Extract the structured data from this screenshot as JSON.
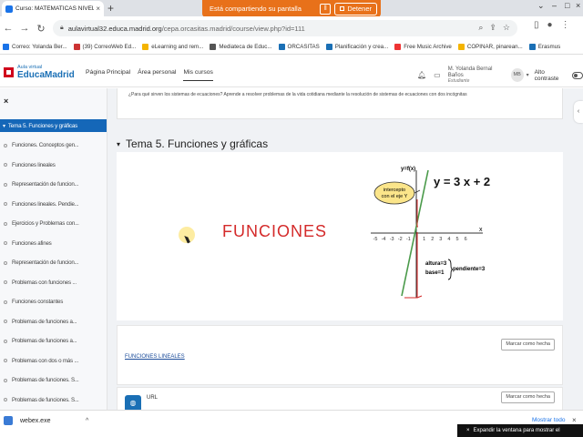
{
  "browser": {
    "tab_title": "Curso: MATEMATICAS NIVEL II D",
    "tab_close": "×",
    "new_tab": "+",
    "share_message": "Está compartiendo su pantalla",
    "pause_icon": "pause-icon",
    "stop_label": "Detener",
    "url_host": "aulavirtual32.educa.madrid.org",
    "url_path": "/cepa.orcasitas.madrid/course/view.php?id=111",
    "bookmarks": [
      {
        "label": "Correo: Yolanda Ber...",
        "color": "#1a73e8"
      },
      {
        "label": "(39) CorreoWeb Ed...",
        "color": "#c33"
      },
      {
        "label": "eLearning and rem...",
        "color": "#f4b400"
      },
      {
        "label": "Mediateca de Educ...",
        "color": "#555"
      },
      {
        "label": "ORCASITAS",
        "color": "#1a6fb5"
      },
      {
        "label": "Planificación y crea...",
        "color": "#1a6fb5"
      },
      {
        "label": "Free Music Archive",
        "color": "#e33"
      },
      {
        "label": "COPINAR, pinarean...",
        "color": "#f4b400"
      },
      {
        "label": "Erasmus",
        "color": "#1a6fb5"
      }
    ]
  },
  "site": {
    "logo_sub": "Aula virtual",
    "logo_main": "EducaMadrid",
    "nav": [
      "Página Principal",
      "Área personal",
      "Mis cursos"
    ],
    "user_name": "M. Yolanda Bernal Baños",
    "user_role": "Estudiante",
    "avatar_initials": "MB",
    "contrast_label": "Alto contraste"
  },
  "drawer": {
    "close": "×",
    "section_title": "Tema 5. Funciones y gráficas",
    "items": [
      "Funciones. Conceptos gen...",
      "Funciones lineales",
      "Representación de funcion...",
      "Funciones lineales. Pendie...",
      "Ejercicios y Problemas con...",
      "Funciones afines",
      "Representación de funcion...",
      "Problemas con funciones ...",
      "Funciones constantes",
      "Problemas de funciones a...",
      "Problemas de funciones a...",
      "Problemas con dos o más ...",
      "Problemas de funciones. S...",
      "Problemas de funciones. S..."
    ]
  },
  "main": {
    "intro_text": "¿Para qué sirven los sistemas de ecuaciones? Aprende a resolver problemas de la vida cotidiana mediante la resolución de sistemas de ecuaciones con dos incógnitas",
    "section_title": "Tema 5. Funciones y gráficas",
    "figure_title": "FUNCIONES",
    "graph": {
      "equation": "y = 3 x + 2",
      "y_axis_label": "y=f(x)",
      "x_axis_label": "x",
      "intercept_label_1": "intercepto",
      "intercept_label_2": "con el eje Y",
      "rise_label": "altura=3",
      "run_label": "base=1",
      "slope_label": "pendiente=3",
      "x_ticks": [
        "-5",
        "-4",
        "-3",
        "-2",
        "-1",
        "1",
        "2",
        "3",
        "4",
        "5",
        "6"
      ]
    },
    "activities": [
      {
        "title": "FUNCIONES LINEALES",
        "button": "Marcar como hecha"
      },
      {
        "type_label": "URL",
        "button": "Marcar como hecha"
      }
    ]
  },
  "downloads": {
    "file": "webex.exe",
    "show_all": "Mostrar todo",
    "close": "×",
    "tooltip": "Expandir la ventana para mostrar el"
  }
}
